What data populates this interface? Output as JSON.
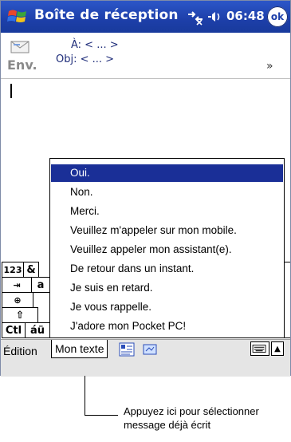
{
  "window": {
    "title": "Boîte de réception",
    "clock": "06:48",
    "ok_label": "ok"
  },
  "header": {
    "send_label": "Env.",
    "to_row": "À: < ... >",
    "subject_row": "Obj: < ... >"
  },
  "keyboard": {
    "visible_keys": [
      "123",
      "&",
      "a",
      "Ctl",
      "áü",
      "⇧"
    ]
  },
  "popup": {
    "items": [
      "Oui.",
      "Non.",
      "Merci.",
      "Veuillez m'appeler sur mon mobile.",
      "Veuillez appeler mon assistant(e).",
      "De retour dans un instant.",
      "Je suis en retard.",
      "Je vous rappelle.",
      "J'adore mon Pocket PC!"
    ],
    "selected_index": 0
  },
  "menubar": {
    "edit_label": "Édition",
    "my_text_label": "Mon texte"
  },
  "callout": {
    "line1": "Appuyez ici pour sélectionner",
    "line2": "message déjà écrit"
  },
  "colors": {
    "titlebar": "#1d3fa9",
    "selection": "#1a2f97",
    "menubar": "#e5e5e5"
  }
}
